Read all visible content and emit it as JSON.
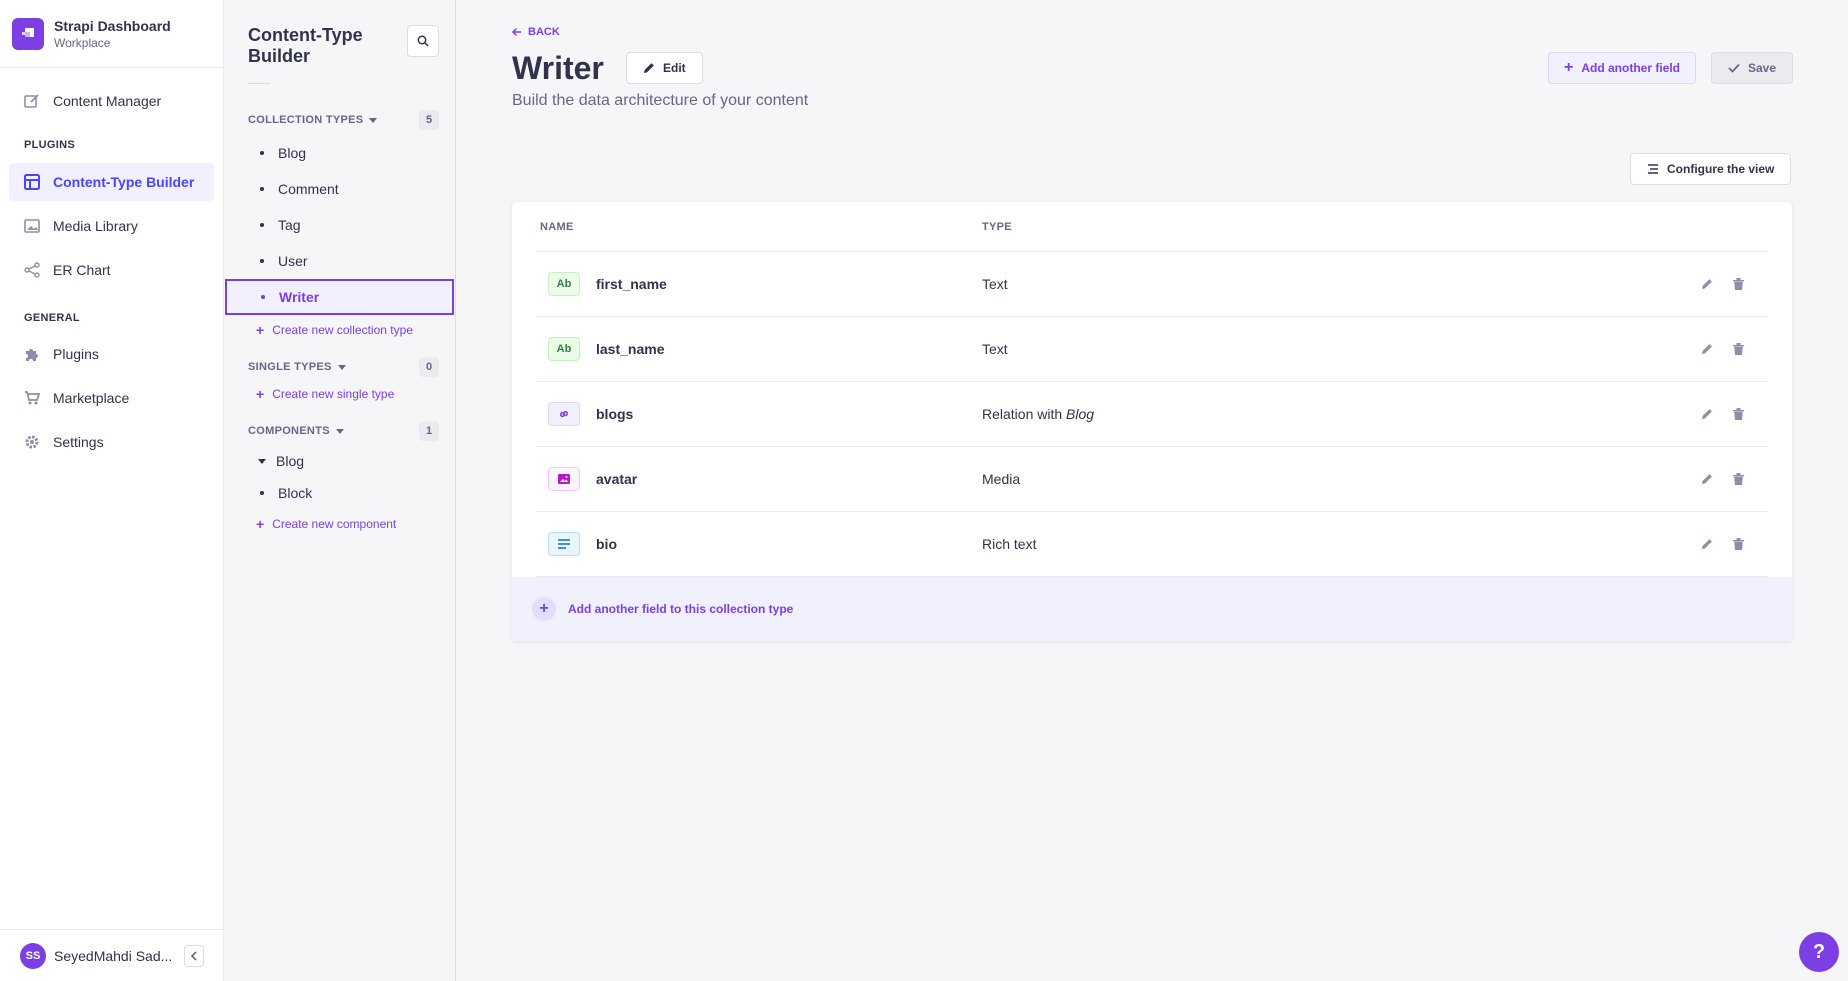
{
  "brand": {
    "title": "Strapi Dashboard",
    "subtitle": "Workplace"
  },
  "mainnav": {
    "content_manager": "Content Manager",
    "plugins_section": "PLUGINS",
    "plugins": [
      "Content-Type Builder",
      "Media Library",
      "ER Chart"
    ],
    "general_section": "GENERAL",
    "general": [
      "Plugins",
      "Marketplace",
      "Settings"
    ]
  },
  "user": {
    "initials": "SS",
    "name": "SeyedMahdi Sad..."
  },
  "subnav": {
    "title": "Content-Type Builder",
    "collection_types": {
      "label": "COLLECTION TYPES",
      "count": "5",
      "items": [
        "Blog",
        "Comment",
        "Tag",
        "User",
        "Writer"
      ],
      "active": "Writer",
      "create": "Create new collection type"
    },
    "single_types": {
      "label": "SINGLE TYPES",
      "count": "0",
      "create": "Create new single type"
    },
    "components": {
      "label": "COMPONENTS",
      "count": "1",
      "group": "Blog",
      "items": [
        "Block"
      ],
      "create": "Create new component"
    }
  },
  "header": {
    "back": "BACK",
    "title": "Writer",
    "edit": "Edit",
    "subtitle": "Build the data architecture of your content",
    "add_field": "Add another field",
    "save": "Save",
    "configure": "Configure the view"
  },
  "table": {
    "columns": [
      "NAME",
      "TYPE"
    ],
    "rows": [
      {
        "icon": "Ab",
        "icon_kind": "text",
        "name": "first_name",
        "type": "Text",
        "type_target": ""
      },
      {
        "icon": "Ab",
        "icon_kind": "text",
        "name": "last_name",
        "type": "Text",
        "type_target": ""
      },
      {
        "icon": "relation-icon",
        "icon_kind": "relation",
        "name": "blogs",
        "type": "Relation with ",
        "type_target": "Blog"
      },
      {
        "icon": "media-icon",
        "icon_kind": "media",
        "name": "avatar",
        "type": "Media",
        "type_target": ""
      },
      {
        "icon": "richtext-icon",
        "icon_kind": "rich",
        "name": "bio",
        "type": "Rich text",
        "type_target": ""
      }
    ],
    "add_row": "Add another field to this collection type"
  },
  "help": "?",
  "colors": {
    "accent": "#7b3fe4",
    "primary": "#4945ff"
  }
}
